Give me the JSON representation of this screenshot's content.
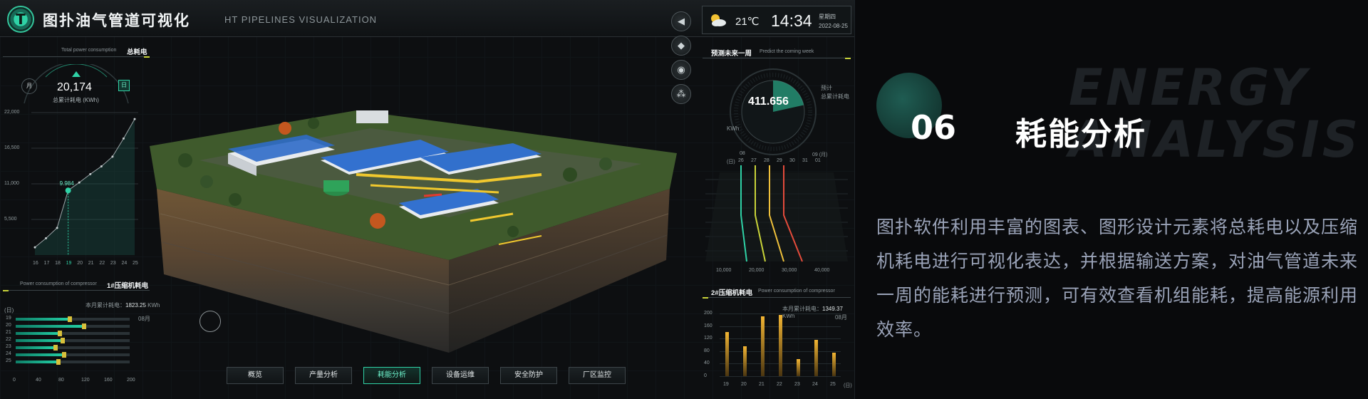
{
  "header": {
    "logo_glyph": "T",
    "title": "图扑油气管道可视化",
    "subtitle": "HT PIPELINES VISUALIZATION"
  },
  "weather": {
    "icon": "partly-cloudy-icon",
    "temperature": "21℃",
    "time": "14:34",
    "weekday": "星期四",
    "date": "2022-08-25"
  },
  "controls": [
    {
      "icon": "home-arrow-icon",
      "glyph": "◀"
    },
    {
      "icon": "cube-view-icon",
      "glyph": "◆"
    },
    {
      "icon": "camera-icon",
      "glyph": "◉"
    },
    {
      "icon": "network-icon",
      "glyph": "⁂"
    }
  ],
  "total_power": {
    "title_en": "Total power consumption",
    "title_zh": "总耗电",
    "month_label": "月",
    "day_label": "日",
    "value": "20,174",
    "unit_label": "总累计耗电 (KWh)",
    "marker_value": "9.984"
  },
  "total_power_chart": {
    "type": "line",
    "y_ticks": [
      "22,000",
      "16,500",
      "11,000",
      "5,500"
    ],
    "x_ticks": [
      "16",
      "17",
      "18",
      "19",
      "20",
      "21",
      "22",
      "23",
      "24",
      "25"
    ],
    "highlight_x": "19",
    "ylim": [
      0,
      22000
    ],
    "values": [
      1200,
      2600,
      4200,
      9984,
      11200,
      12500,
      13700,
      15200,
      18000,
      21000
    ]
  },
  "compressor1": {
    "title_en": "Power consumption of compressor",
    "title_zh": "1#压缩机耗电",
    "month_total_label": "本月累计耗电：",
    "month_total_value": "1823.25",
    "unit": "KWh",
    "y_axis_label": "(日)",
    "month_label": "08月",
    "rows": [
      {
        "day": "19",
        "value": 95
      },
      {
        "day": "20",
        "value": 120
      },
      {
        "day": "21",
        "value": 78
      },
      {
        "day": "22",
        "value": 82
      },
      {
        "day": "23",
        "value": 70
      },
      {
        "day": "24",
        "value": 85
      },
      {
        "day": "25",
        "value": 75
      }
    ],
    "x_ticks": [
      "0",
      "40",
      "80",
      "120",
      "160",
      "200"
    ]
  },
  "forecast": {
    "title_zh": "预测未来一周",
    "title_en": "Predict the coming week",
    "value": "411.656",
    "unit": "KWh",
    "legend_line1": "预计",
    "legend_line2": "总累计耗电",
    "level_fraction": 0.12,
    "month_start": "08",
    "month_end": "09 (月)",
    "day_axis_label": "(日)",
    "days": [
      "26",
      "27",
      "28",
      "29",
      "30",
      "31",
      "01"
    ],
    "x_ticks": [
      "10,000",
      "20,000",
      "30,000",
      "40,000"
    ],
    "line_colors": [
      "#2fd2a6",
      "#c8d339",
      "#f0c13b",
      "#e34b3b"
    ]
  },
  "compressor2": {
    "title_zh": "2#压缩机耗电",
    "title_en": "Power consumption of compressor",
    "month_total_label": "本月累计耗电：",
    "month_total_value": "1349.37",
    "unit": "KWh",
    "month_label": "08月",
    "y_ticks": [
      "200",
      "160",
      "120",
      "80",
      "40",
      "0"
    ],
    "x_ticks": [
      "19",
      "20",
      "21",
      "22",
      "23",
      "24",
      "25"
    ],
    "x_axis_label": "(日)",
    "ylim": [
      0,
      200
    ],
    "values": [
      140,
      95,
      190,
      195,
      55,
      115,
      75
    ]
  },
  "nav": [
    {
      "label": "概览",
      "active": false
    },
    {
      "label": "产量分析",
      "active": false
    },
    {
      "label": "耗能分析",
      "active": true
    },
    {
      "label": "设备运维",
      "active": false
    },
    {
      "label": "安全防护",
      "active": false
    },
    {
      "label": "厂区监控",
      "active": false
    }
  ],
  "slide": {
    "ghost_line1": "ENERGY",
    "ghost_line2": "ANALYSIS",
    "number": "06",
    "title": "耗能分析",
    "paragraph": "图扑软件利用丰富的图表、图形设计元素将总耗电以及压缩机耗电进行可视化表达，并根据输送方案，对油气管道未来一周的能耗进行预测，可有效查看机组能耗，提高能源利用效率。"
  },
  "colors": {
    "accent_teal": "#2fd2a6",
    "accent_yellow": "#c8d339",
    "bar_gold": "#f2b533"
  }
}
